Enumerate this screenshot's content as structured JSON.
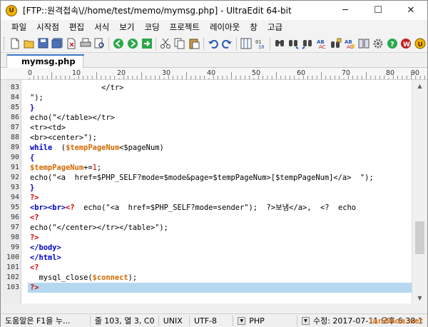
{
  "window": {
    "title": "[FTP::원격접속\\//home/test/memo/mymsg.php] - UltraEdit 64-bit",
    "minimize": "─",
    "maximize": "☐",
    "close": "✕"
  },
  "menu": [
    "파일",
    "시작점",
    "편집",
    "서식",
    "보기",
    "코딩",
    "프로젝트",
    "레이아웃",
    "창",
    "고급"
  ],
  "tab": {
    "label": "mymsg.php"
  },
  "ruler": {
    "labels": [
      "0",
      "10",
      "20",
      "30",
      "40",
      "50",
      "60",
      "70",
      "80",
      "90"
    ]
  },
  "editor": {
    "lines": [
      {
        "n": "83",
        "segs": [
          {
            "t": "                <",
            "c": ""
          },
          {
            "t": "/tr>",
            "c": ""
          }
        ]
      },
      {
        "n": "84",
        "segs": [
          {
            "t": "\");",
            "c": ""
          }
        ]
      },
      {
        "n": "85",
        "segs": [
          {
            "t": "}",
            "c": "kw"
          }
        ]
      },
      {
        "n": "86",
        "segs": [
          {
            "t": "echo",
            "c": "fn"
          },
          {
            "t": "(\"</table></tr>",
            "c": ""
          }
        ]
      },
      {
        "n": "87",
        "segs": [
          {
            "t": "<tr><td>",
            "c": ""
          }
        ]
      },
      {
        "n": "88",
        "segs": [
          {
            "t": "<br><center>\");",
            "c": ""
          }
        ]
      },
      {
        "n": "89",
        "segs": [
          {
            "t": "while",
            "c": "kw"
          },
          {
            "t": "  (",
            "c": ""
          },
          {
            "t": "$tempPageNum",
            "c": "var"
          },
          {
            "t": "<",
            "c": ""
          },
          {
            "t": "$pageNum",
            "c": "fn"
          },
          {
            "t": ")",
            "c": ""
          }
        ]
      },
      {
        "n": "90",
        "segs": [
          {
            "t": "{",
            "c": "kw"
          }
        ]
      },
      {
        "n": "91",
        "segs": [
          {
            "t": "$tempPageNum",
            "c": "var"
          },
          {
            "t": "+=",
            "c": ""
          },
          {
            "t": "1",
            "c": "num"
          },
          {
            "t": ";",
            "c": ""
          }
        ]
      },
      {
        "n": "92",
        "segs": [
          {
            "t": "echo",
            "c": "fn"
          },
          {
            "t": "(\"<a  href=$PHP_SELF?mode=$mode&page=$tempPageNum>[$tempPageNum]</a>  \");",
            "c": ""
          }
        ]
      },
      {
        "n": "93",
        "segs": [
          {
            "t": "}",
            "c": "kw"
          }
        ]
      },
      {
        "n": "94",
        "segs": [
          {
            "t": "?>",
            "c": "tag"
          }
        ]
      },
      {
        "n": "95",
        "segs": [
          {
            "t": "<br><br>",
            "c": "kw"
          },
          {
            "t": "<?",
            "c": "tag"
          },
          {
            "t": "  echo(\"<a  href=$PHP_SELF?mode=sender\");  ?>보냄</a>,  <?  echo",
            "c": ""
          }
        ]
      },
      {
        "n": "96",
        "segs": [
          {
            "t": "<?",
            "c": "tag"
          }
        ]
      },
      {
        "n": "97",
        "segs": [
          {
            "t": "echo",
            "c": "fn"
          },
          {
            "t": "(\"</center></tr></table>\");",
            "c": ""
          }
        ]
      },
      {
        "n": "98",
        "segs": [
          {
            "t": "?>",
            "c": "tag"
          }
        ]
      },
      {
        "n": "99",
        "segs": [
          {
            "t": "</body>",
            "c": "kw"
          }
        ]
      },
      {
        "n": "100",
        "segs": [
          {
            "t": "</html>",
            "c": "kw"
          }
        ]
      },
      {
        "n": "101",
        "segs": [
          {
            "t": "<?",
            "c": "tag"
          }
        ]
      },
      {
        "n": "102",
        "segs": [
          {
            "t": "  mysql_close(",
            "c": ""
          },
          {
            "t": "$connect",
            "c": "var"
          },
          {
            "t": ");",
            "c": ""
          }
        ]
      },
      {
        "n": "103",
        "segs": [
          {
            "t": "?>",
            "c": "tag"
          }
        ]
      }
    ]
  },
  "status": {
    "help": "도움말은 F1을 누...",
    "position": "줄 103, 열 3, C0",
    "line_ending": "UNIX",
    "encoding": "UTF-8",
    "syntax": "PHP",
    "modified": "수정: 2017-07-11 오후 6:38:1",
    "watermark": "landhoa.net"
  },
  "colors": {
    "keyword": "#0000cc",
    "variable": "#d26a00",
    "php_tag": "#cc0000",
    "current_line": "#b5d8f0",
    "tab_accent": "#3b78c8"
  }
}
